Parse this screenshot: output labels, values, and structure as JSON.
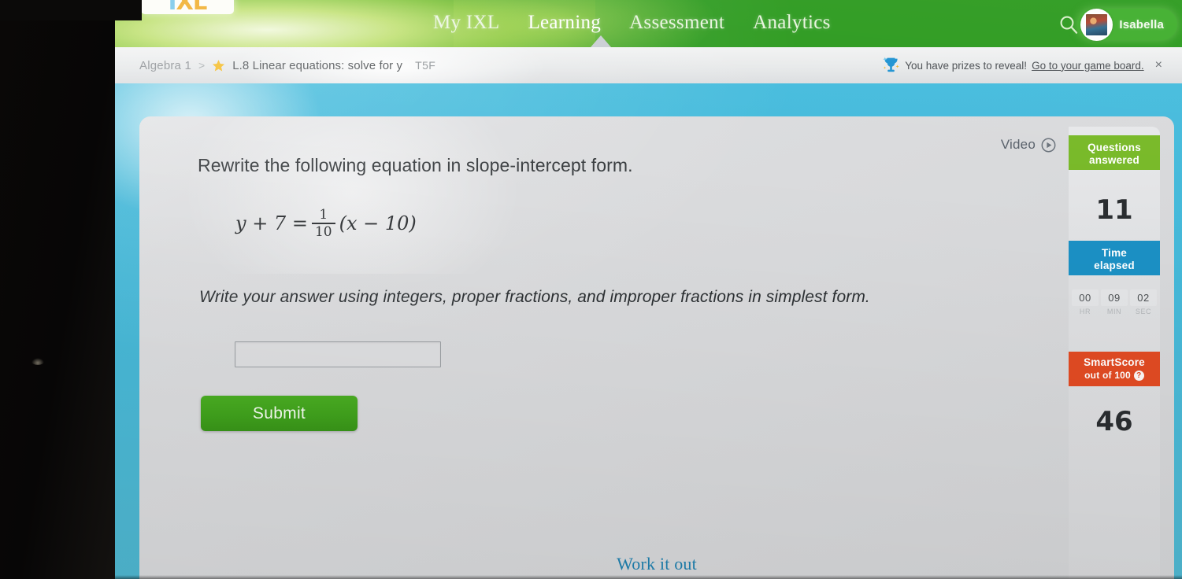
{
  "header": {
    "logo_text": "IXL",
    "nav_items": [
      {
        "label": "My IXL",
        "active": false
      },
      {
        "label": "Learning",
        "active": true
      },
      {
        "label": "Assessment",
        "active": false
      },
      {
        "label": "Analytics",
        "active": false
      }
    ],
    "search_icon": "search-icon",
    "user_name": "Isabella",
    "nav_bg_color": "#2c9a1e"
  },
  "breadcrumb": {
    "course": "Algebra 1",
    "separator": ">",
    "star_icon": "star-icon",
    "skill": "L.8 Linear equations: solve for y",
    "code": "T5F"
  },
  "prize_banner": {
    "trophy_icon": "trophy-icon",
    "message": "You have prizes to reveal!",
    "link": "Go to your game board.",
    "close_icon": "×"
  },
  "main": {
    "video_label": "Video",
    "play_icon": "play-circle-icon",
    "question": "Rewrite the following equation in slope-intercept form.",
    "equation": {
      "lhs": "y + 7 = ",
      "numerator": "1",
      "denominator": "10",
      "rhs": "(x − 10)",
      "full_text": "y + 7 = 1/10(x − 10)"
    },
    "instruction": "Write your answer using integers, proper fractions, and improper fractions in simplest form.",
    "answer_value": "",
    "answer_placeholder": "",
    "submit_label": "Submit",
    "work_it_out_label": "Work it out",
    "pencil_icon": "pencil-icon",
    "submit_color": "#3fa01c"
  },
  "scorebar": {
    "questions_label_line1": "Questions",
    "questions_label_line2": "answered",
    "questions_value": "11",
    "questions_color": "#78b928",
    "time_label_line1": "Time",
    "time_label_line2": "elapsed",
    "time_color": "#1b90c4",
    "timer": [
      {
        "value": "00",
        "unit": "HR"
      },
      {
        "value": "09",
        "unit": "MIN"
      },
      {
        "value": "02",
        "unit": "SEC"
      }
    ],
    "smartscore_label": "SmartScore",
    "smartscore_sub": "out of 100",
    "smartscore_help_icon": "?",
    "smartscore_value": "46",
    "smartscore_color": "#e04a23"
  }
}
